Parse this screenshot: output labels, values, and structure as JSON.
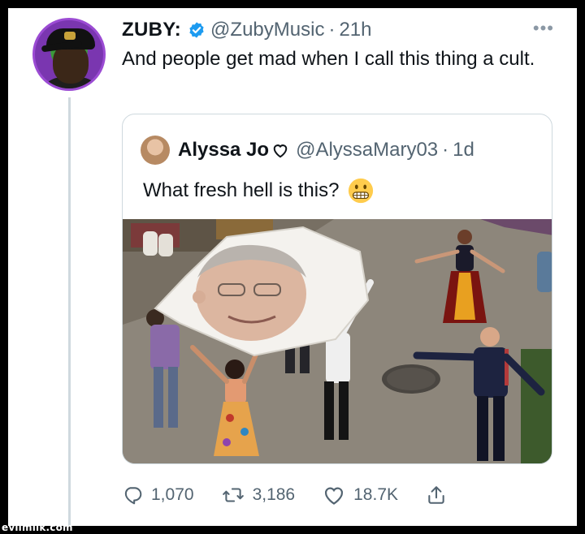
{
  "tweet": {
    "display_name": "ZUBY:",
    "handle": "@ZubyMusic",
    "separator": "·",
    "time": "21h",
    "more_label": "•••",
    "text": "And people get mad when I call this thing a cult.",
    "verified_icon": "verified-badge-icon",
    "accent_color": "#1d9bf0"
  },
  "quote": {
    "display_name": "Alyssa Jo",
    "name_icon": "heart-outline-icon",
    "handle": "@AlyssaMary03",
    "separator": "·",
    "time": "1d",
    "text": "What fresh hell is this?",
    "emoji_icon": "grimacing-face-icon",
    "media": "video-still"
  },
  "actions": {
    "replies": "1,070",
    "retweets": "3,186",
    "likes": "18.7K",
    "reply_icon": "reply-icon",
    "retweet_icon": "retweet-icon",
    "like_icon": "heart-icon",
    "share_icon": "share-icon"
  },
  "watermark": "evilmilk.com"
}
